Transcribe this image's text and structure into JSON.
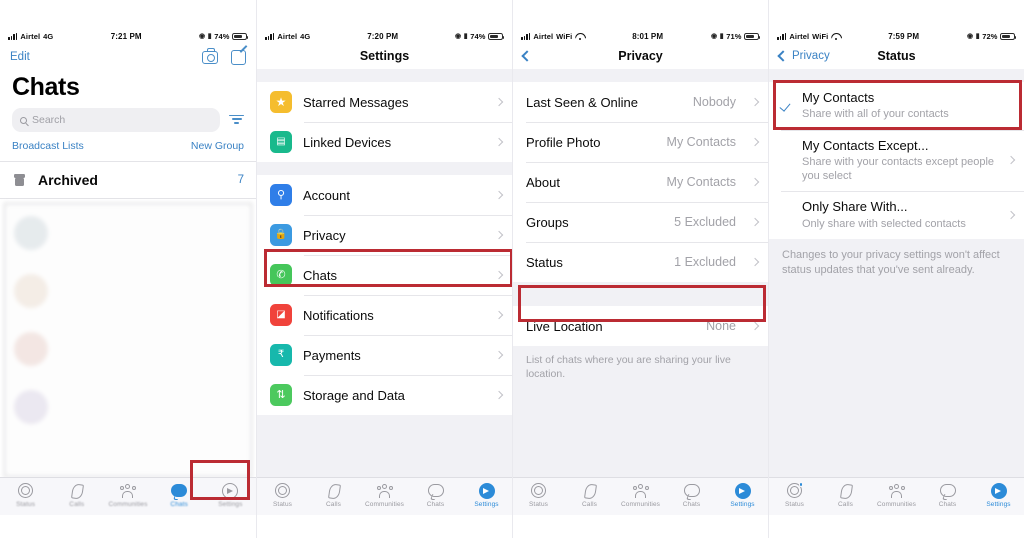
{
  "meta": {
    "accent_blue": "#3a82c4",
    "highlight_red": "#bb2b33",
    "tab_active": "#2c8bd8"
  },
  "panels": [
    {
      "id": "chats",
      "status_bar": {
        "carrier": "Airtel",
        "network": "4G",
        "time": "7:21 PM",
        "battery": "74%"
      },
      "nav": {
        "left_label": "Edit"
      },
      "title": "Chats",
      "search": {
        "placeholder": "Search"
      },
      "broadcast_label": "Broadcast Lists",
      "new_group_label": "New Group",
      "archived": {
        "label": "Archived",
        "count": "7"
      }
    },
    {
      "id": "settings",
      "status_bar": {
        "carrier": "Airtel",
        "network": "4G",
        "time": "7:20 PM",
        "battery": "74%"
      },
      "title": "Settings",
      "groups": [
        {
          "rows": [
            {
              "label": "Starred Messages",
              "icon": "star-icon",
              "color": "#f5bd2e",
              "glyph": "★"
            },
            {
              "label": "Linked Devices",
              "icon": "laptop-icon",
              "color": "#19b98c",
              "glyph": "▤"
            }
          ]
        },
        {
          "rows": [
            {
              "label": "Account",
              "icon": "key-icon",
              "color": "#2f7ee8",
              "glyph": "⚲"
            },
            {
              "label": "Privacy",
              "icon": "lock-icon",
              "color": "#3b9ae1",
              "glyph": "🔒",
              "highlighted": true
            },
            {
              "label": "Chats",
              "icon": "whatsapp-chat-icon",
              "color": "#45c65a",
              "glyph": "✆"
            },
            {
              "label": "Notifications",
              "icon": "bell-icon",
              "color": "#f0433b",
              "glyph": "◪"
            },
            {
              "label": "Payments",
              "icon": "rupee-icon",
              "color": "#17b8ac",
              "glyph": "₹"
            },
            {
              "label": "Storage and Data",
              "icon": "arrows-icon",
              "color": "#4cc95e",
              "glyph": "⇅"
            }
          ]
        }
      ]
    },
    {
      "id": "privacy",
      "status_bar": {
        "carrier": "Airtel",
        "network": "WiFi",
        "time": "8:01 PM",
        "battery": "71%"
      },
      "title": "Privacy",
      "groups": [
        {
          "rows": [
            {
              "label": "Last Seen & Online",
              "value": "Nobody"
            },
            {
              "label": "Profile Photo",
              "value": "My Contacts"
            },
            {
              "label": "About",
              "value": "My Contacts"
            },
            {
              "label": "Groups",
              "value": "5 Excluded"
            },
            {
              "label": "Status",
              "value": "1 Excluded",
              "highlighted": true
            }
          ]
        },
        {
          "rows": [
            {
              "label": "Live Location",
              "value": "None"
            }
          ],
          "footer": "List of chats where you are sharing your live location."
        }
      ]
    },
    {
      "id": "status",
      "status_bar": {
        "carrier": "Airtel",
        "network": "WiFi",
        "time": "7:59 PM",
        "battery": "72%"
      },
      "back_label": "Privacy",
      "title": "Status",
      "options": [
        {
          "title": "My Contacts",
          "subtitle": "Share with all of your contacts",
          "checked": true,
          "chevron": false,
          "highlighted": true
        },
        {
          "title": "My Contacts Except...",
          "subtitle": "Share with your contacts except people you select",
          "checked": false,
          "chevron": true
        },
        {
          "title": "Only Share With...",
          "subtitle": "Only share with selected contacts",
          "checked": false,
          "chevron": true
        }
      ],
      "footer": "Changes to your privacy settings won't affect status updates that you've sent already."
    }
  ],
  "tabbar": {
    "items": [
      {
        "label": "Status",
        "icon": "status-rings-icon"
      },
      {
        "label": "Calls",
        "icon": "phone-icon"
      },
      {
        "label": "Communities",
        "icon": "communities-icon"
      },
      {
        "label": "Chats",
        "icon": "chat-bubble-icon"
      },
      {
        "label": "Settings",
        "icon": "settings-gear-icon"
      }
    ],
    "active_by_panel": [
      "Chats",
      "Settings",
      "Settings",
      "Settings"
    ]
  }
}
